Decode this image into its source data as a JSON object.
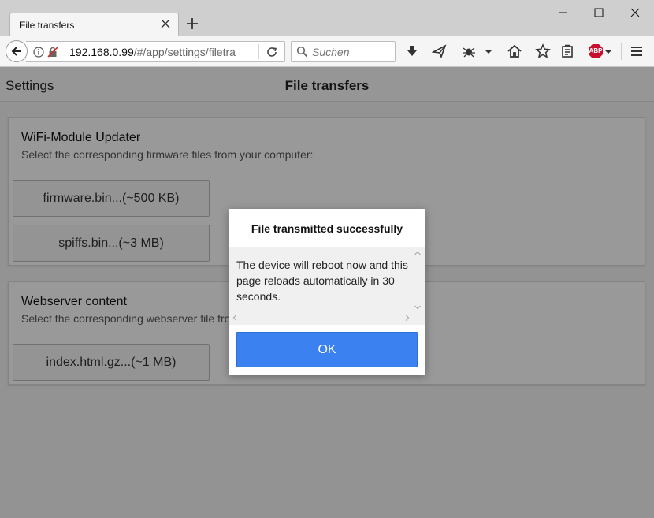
{
  "browser": {
    "tab_title": "File transfers",
    "url_host": "192.168.0.99",
    "url_path": "/#/app/settings/filetra",
    "search_placeholder": "Suchen",
    "abp_label": "ABP"
  },
  "app": {
    "nav_settings": "Settings",
    "page_title": "File transfers"
  },
  "cards": [
    {
      "title": "WiFi-Module Updater",
      "subtitle": "Select the corresponding firmware files from your computer:",
      "buttons": [
        "firmware.bin...(~500 KB)",
        "spiffs.bin...(~3 MB)"
      ]
    },
    {
      "title": "Webserver content",
      "subtitle": "Select the corresponding webserver file from your computer:",
      "buttons": [
        "index.html.gz...(~1 MB)"
      ]
    }
  ],
  "dialog": {
    "title": "File transmitted successfully",
    "message": "The device will reboot now and this page reloads automatically in 30 seconds.",
    "ok_label": "OK"
  },
  "colors": {
    "ok_button": "#3b82f0",
    "abp_badge": "#c8102e"
  }
}
